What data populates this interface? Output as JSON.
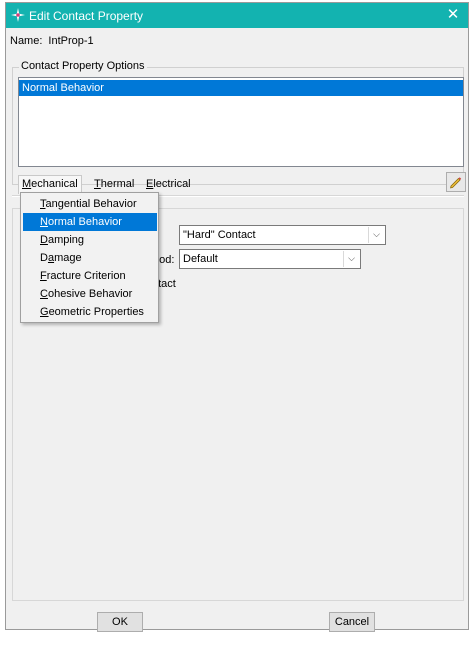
{
  "window": {
    "title": "Edit Contact Property",
    "close_glyph": "✕"
  },
  "name_row": {
    "label": "Name:",
    "value": "IntProp-1"
  },
  "options_group": {
    "label": "Contact Property Options",
    "items": [
      "Normal Behavior"
    ],
    "selected_index": 0
  },
  "menubar": {
    "items": [
      {
        "label": "Mechanical",
        "mnemonic": "M",
        "rest": "echanical",
        "active": true
      },
      {
        "label": "Thermal",
        "mnemonic": "T",
        "rest": "hermal",
        "active": false
      },
      {
        "label": "Electrical",
        "mnemonic": "E",
        "rest": "lectrical",
        "active": false
      }
    ]
  },
  "mechanical_menu": {
    "items": [
      {
        "label": "Tangential Behavior",
        "mnemonic": "T",
        "rest": "angential Behavior",
        "highlighted": false
      },
      {
        "label": "Normal Behavior",
        "mnemonic": "N",
        "rest": "ormal Behavior",
        "highlighted": true
      },
      {
        "label": "Damping",
        "mnemonic": "D",
        "rest": "amping",
        "highlighted": false
      },
      {
        "label": "Damage",
        "mnemonic": "",
        "rest": "",
        "pre": "D",
        "u": "a",
        "post": "mage",
        "highlighted": false
      },
      {
        "label": "Fracture Criterion",
        "mnemonic": "F",
        "rest": "racture Criterion",
        "highlighted": false
      },
      {
        "label": "Cohesive Behavior",
        "mnemonic": "C",
        "rest": "ohesive Behavior",
        "highlighted": false
      },
      {
        "label": "Geometric Properties",
        "mnemonic": "G",
        "rest": "eometric Properties",
        "highlighted": false
      }
    ]
  },
  "normal_behavior": {
    "pressure_overclosure": {
      "value": "\"Hard\" Contact"
    },
    "constraint_method": {
      "label_fragment": "hod:",
      "value": "Default"
    },
    "separation_fragment": "ntact"
  },
  "buttons": {
    "ok": "OK",
    "cancel": "Cancel"
  },
  "icons": {
    "app": "abaqus-star-icon",
    "edit": "pencil-icon",
    "combo_arrow": "chevron-down-icon"
  },
  "colors": {
    "titlebar": "#13b3b0",
    "selection": "#0078d7"
  }
}
